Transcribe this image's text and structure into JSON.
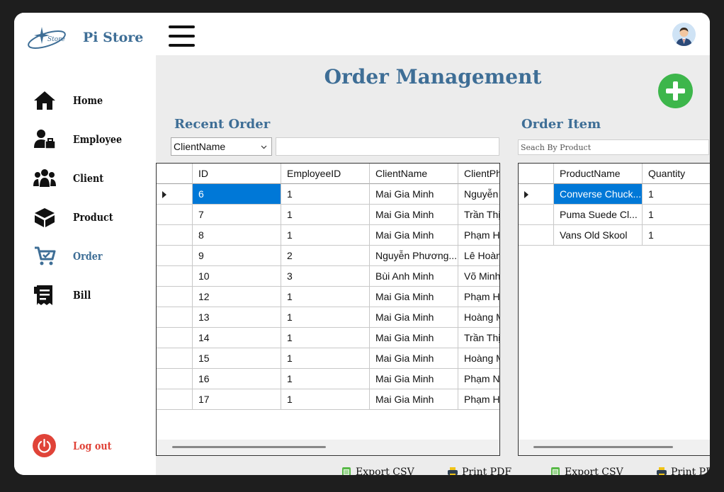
{
  "app": {
    "brand": "Pi Store"
  },
  "sidebar": {
    "items": [
      {
        "label": "Home",
        "icon": "home-icon"
      },
      {
        "label": "Employee",
        "icon": "employee-icon"
      },
      {
        "label": "Client",
        "icon": "client-icon"
      },
      {
        "label": "Product",
        "icon": "product-icon"
      },
      {
        "label": "Order",
        "icon": "cart-icon",
        "active": true
      },
      {
        "label": "Bill",
        "icon": "bill-icon"
      }
    ],
    "logout": "Log out"
  },
  "page": {
    "title": "Order Management",
    "recent_order_title": "Recent Order",
    "order_item_title": "Order Item",
    "filter_selected": "ClientName",
    "filter_value": "",
    "search_placeholder": "Seach By Product"
  },
  "orders": {
    "columns": [
      "ID",
      "EmployeeID",
      "ClientName",
      "ClientPh"
    ],
    "rows": [
      [
        "6",
        "1",
        "Mai Gia Minh",
        "Nguyễn"
      ],
      [
        "7",
        "1",
        "Mai Gia Minh",
        "Trần Thị"
      ],
      [
        "8",
        "1",
        "Mai Gia Minh",
        "Phạm Hồ"
      ],
      [
        "9",
        "2",
        "Nguyễn Phương...",
        "Lê Hoàn"
      ],
      [
        "10",
        "3",
        "Bùi Anh Minh",
        "Võ Minh"
      ],
      [
        "12",
        "1",
        "Mai Gia Minh",
        "Phạm Hồ"
      ],
      [
        "13",
        "1",
        "Mai Gia Minh",
        "Hoàng M"
      ],
      [
        "14",
        "1",
        "Mai Gia Minh",
        "Trần Thị"
      ],
      [
        "15",
        "1",
        "Mai Gia Minh",
        "Hoàng M"
      ],
      [
        "16",
        "1",
        "Mai Gia Minh",
        "Phạm Nh"
      ],
      [
        "17",
        "1",
        "Mai Gia Minh",
        "Phạm Hồ"
      ]
    ]
  },
  "items": {
    "columns": [
      "ProductName",
      "Quantity"
    ],
    "rows": [
      [
        "Converse Chuck...",
        "1"
      ],
      [
        "Puma Suede Cl...",
        "1"
      ],
      [
        "Vans Old Skool",
        "1"
      ]
    ]
  },
  "footer": {
    "export_csv": "Export CSV",
    "print_pdf": "Print PDF"
  },
  "colors": {
    "accent": "#3e6e96",
    "selection": "#0078d7",
    "add_button": "#3db64b",
    "logout": "#e04338"
  }
}
